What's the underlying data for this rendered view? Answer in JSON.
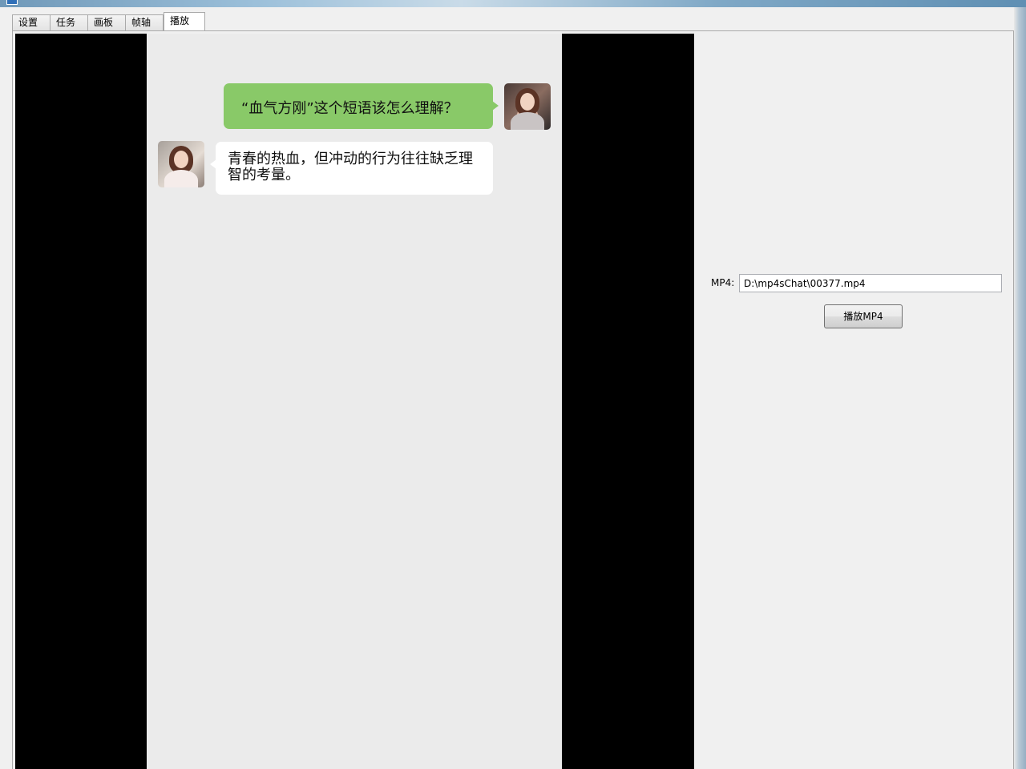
{
  "tabs": [
    {
      "label": "设置",
      "active": false
    },
    {
      "label": "任务",
      "active": false
    },
    {
      "label": "画板",
      "active": false
    },
    {
      "label": "帧轴",
      "active": false
    },
    {
      "label": "播放",
      "active": true
    }
  ],
  "chat": {
    "question": "“血气方刚”这个短语该怎么理解？",
    "answer": "青春的热血，但冲动的行为往往缺乏理智的考量。",
    "question_bubble_color": "#89c968",
    "answer_bubble_color": "#ffffff",
    "canvas_color": "#ebebeb"
  },
  "player": {
    "mp4_label": "MP4:",
    "mp4_path": "D:\\mp4sChat\\00377.mp4",
    "play_button_label": "播放MP4"
  }
}
